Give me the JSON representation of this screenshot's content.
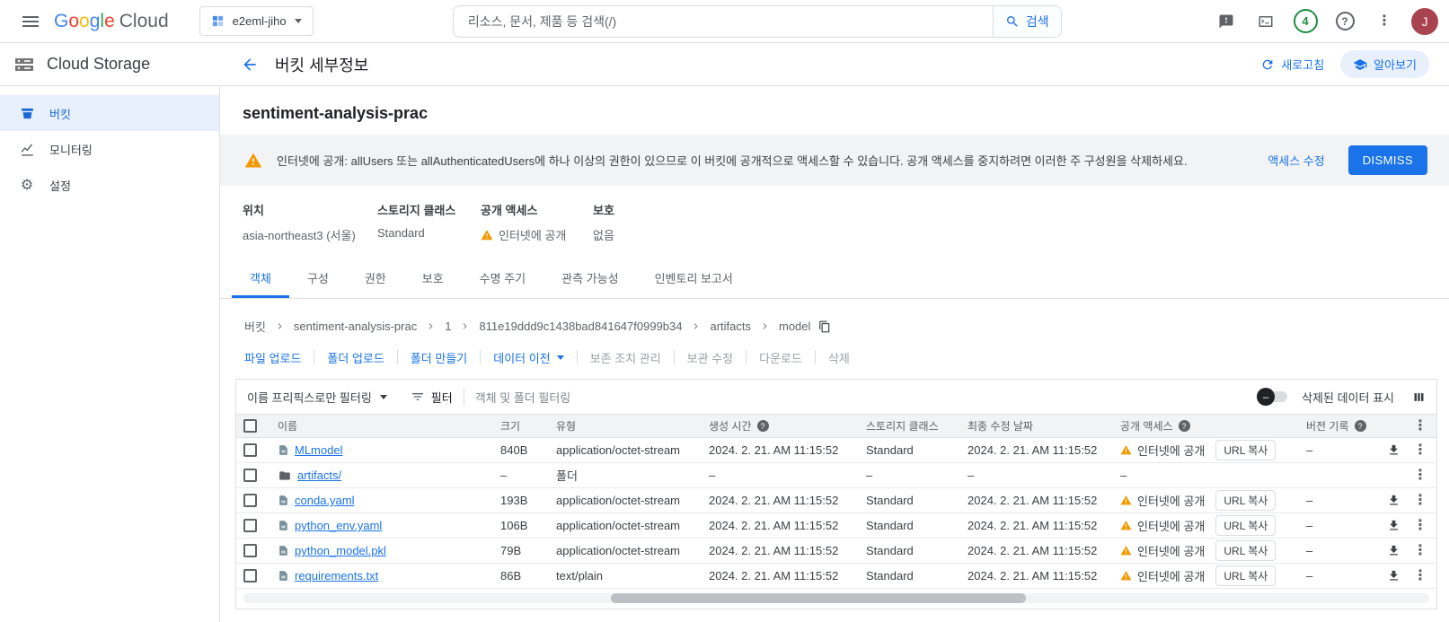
{
  "colors": {
    "accent": "#1a73e8",
    "warning": "#f29900",
    "active_nav_bg": "#e8f0fe"
  },
  "topbar": {
    "logo": {
      "letters": [
        {
          "ch": "G",
          "color": "#4285F4"
        },
        {
          "ch": "o",
          "color": "#EA4335"
        },
        {
          "ch": "o",
          "color": "#FBBC04"
        },
        {
          "ch": "g",
          "color": "#4285F4"
        },
        {
          "ch": "l",
          "color": "#34A853"
        },
        {
          "ch": "e",
          "color": "#EA4335"
        }
      ],
      "suffix": "Cloud"
    },
    "project_name": "e2eml-jiho",
    "search_placeholder": "리소스, 문서, 제품 등 검색(/)",
    "search_button_label": "검색",
    "notification_count": "4",
    "help_glyph": "?",
    "avatar_initial": "J"
  },
  "appbar": {
    "product_title": "Cloud Storage",
    "page_title": "버킷 세부정보",
    "refresh_label": "새로고침",
    "learn_label": "알아보기"
  },
  "sidebar": {
    "items": [
      {
        "label": "버킷",
        "active": true
      },
      {
        "label": "모니터링",
        "active": false
      },
      {
        "label": "설정",
        "active": false
      }
    ]
  },
  "main": {
    "bucket_name": "sentiment-analysis-prac",
    "banner": {
      "message": "인터넷에 공개: allUsers 또는 allAuthenticatedUsers에 하나 이상의 권한이 있으므로 이 버킷에 공개적으로 액세스할 수 있습니다. 공개 액세스를 중지하려면 이러한 주 구성원을 삭제하세요.",
      "edit_access_label": "액세스 수정",
      "dismiss_label": "DISMISS"
    },
    "info": {
      "location_label": "위치",
      "location_value": "asia-northeast3 (서울)",
      "storage_class_label": "스토리지 클래스",
      "storage_class_value": "Standard",
      "public_access_label": "공개 액세스",
      "public_access_value": "인터넷에 공개",
      "protection_label": "보호",
      "protection_value": "없음"
    },
    "tabs": [
      {
        "label": "객체",
        "active": true
      },
      {
        "label": "구성",
        "active": false
      },
      {
        "label": "권한",
        "active": false
      },
      {
        "label": "보호",
        "active": false
      },
      {
        "label": "수명 주기",
        "active": false
      },
      {
        "label": "관측 가능성",
        "active": false
      },
      {
        "label": "인벤토리 보고서",
        "active": false
      }
    ],
    "breadcrumb": [
      {
        "label": "버킷",
        "has_next": true,
        "has_copy": false
      },
      {
        "label": "sentiment-analysis-prac",
        "has_next": true,
        "has_copy": false
      },
      {
        "label": "1",
        "has_next": true,
        "has_copy": false
      },
      {
        "label": "811e19ddd9c1438bad841647f0999b34",
        "has_next": true,
        "has_copy": false
      },
      {
        "label": "artifacts",
        "has_next": true,
        "has_copy": false
      },
      {
        "label": "model",
        "has_next": false,
        "has_copy": true
      }
    ],
    "actions": [
      {
        "label": "파일 업로드",
        "disabled": false,
        "dropdown": false
      },
      {
        "label": "폴더 업로드",
        "disabled": false,
        "dropdown": false
      },
      {
        "label": "폴더 만들기",
        "disabled": false,
        "dropdown": false
      },
      {
        "label": "데이터 이전",
        "disabled": false,
        "dropdown": true
      },
      {
        "label": "보존 조치 관리",
        "disabled": true,
        "dropdown": false
      },
      {
        "label": "보관 수정",
        "disabled": true,
        "dropdown": false
      },
      {
        "label": "다운로드",
        "disabled": true,
        "dropdown": false
      },
      {
        "label": "삭제",
        "disabled": true,
        "dropdown": false
      }
    ],
    "filter_bar": {
      "prefix_filter_label": "이름 프리픽스로만 필터링",
      "filter_chip_label": "필터",
      "filter_placeholder": "객체 및 폴더 필터링",
      "show_deleted_label": "삭제된 데이터 표시"
    },
    "table": {
      "url_copy_label": "URL 복사",
      "headers": {
        "name": "이름",
        "size": "크기",
        "type": "유형",
        "created": "생성 시간",
        "storage_class": "스토리지 클래스",
        "modified": "최종 수정 날짜",
        "public_access": "공개 액세스",
        "version": "버전 기록"
      },
      "rows": [
        {
          "name": "MLmodel",
          "size": "840B",
          "type": "application/octet-stream",
          "created": "2024. 2. 21. AM 11:15:52",
          "storage_class": "Standard",
          "modified": "2024. 2. 21. AM 11:15:52",
          "public": "인터넷에 공개",
          "has_public": true,
          "version": "–",
          "is_file": true,
          "is_folder": false
        },
        {
          "name": "artifacts/",
          "size": "–",
          "type": "폴더",
          "created": "–",
          "storage_class": "–",
          "modified": "–",
          "public": "–",
          "has_public": false,
          "version": "",
          "is_file": false,
          "is_folder": true
        },
        {
          "name": "conda.yaml",
          "size": "193B",
          "type": "application/octet-stream",
          "created": "2024. 2. 21. AM 11:15:52",
          "storage_class": "Standard",
          "modified": "2024. 2. 21. AM 11:15:52",
          "public": "인터넷에 공개",
          "has_public": true,
          "version": "–",
          "is_file": true,
          "is_folder": false
        },
        {
          "name": "python_env.yaml",
          "size": "106B",
          "type": "application/octet-stream",
          "created": "2024. 2. 21. AM 11:15:52",
          "storage_class": "Standard",
          "modified": "2024. 2. 21. AM 11:15:52",
          "public": "인터넷에 공개",
          "has_public": true,
          "version": "–",
          "is_file": true,
          "is_folder": false
        },
        {
          "name": "python_model.pkl",
          "size": "79B",
          "type": "application/octet-stream",
          "created": "2024. 2. 21. AM 11:15:52",
          "storage_class": "Standard",
          "modified": "2024. 2. 21. AM 11:15:52",
          "public": "인터넷에 공개",
          "has_public": true,
          "version": "–",
          "is_file": true,
          "is_folder": false
        },
        {
          "name": "requirements.txt",
          "size": "86B",
          "type": "text/plain",
          "created": "2024. 2. 21. AM 11:15:52",
          "storage_class": "Standard",
          "modified": "2024. 2. 21. AM 11:15:52",
          "public": "인터넷에 공개",
          "has_public": true,
          "version": "–",
          "is_file": true,
          "is_folder": false
        }
      ]
    }
  }
}
